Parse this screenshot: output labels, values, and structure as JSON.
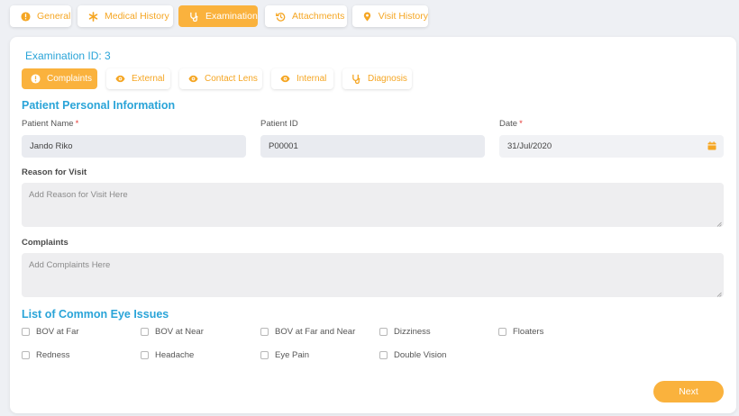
{
  "top_tabs": [
    {
      "label": "General",
      "icon": "info-circle-icon"
    },
    {
      "label": "Medical History",
      "icon": "asterisk-icon"
    },
    {
      "label": "Examination",
      "icon": "stethoscope-icon",
      "active": true
    },
    {
      "label": "Attachments",
      "icon": "history-icon"
    },
    {
      "label": "Visit History",
      "icon": "map-pin-icon"
    }
  ],
  "exam_id": "Examination ID: 3",
  "sub_tabs": [
    {
      "label": "Complaints",
      "icon": "info-circle-icon",
      "active": true
    },
    {
      "label": "External",
      "icon": "eye-icon"
    },
    {
      "label": "Contact Lens",
      "icon": "eye-icon"
    },
    {
      "label": "Internal",
      "icon": "eye-icon"
    },
    {
      "label": "Diagnosis",
      "icon": "stethoscope-icon"
    }
  ],
  "personal": {
    "title": "Patient Personal Information",
    "patient_name_label": "Patient Name",
    "patient_name_value": "Jando Riko",
    "patient_id_label": "Patient ID",
    "patient_id_value": "P00001",
    "date_label": "Date",
    "date_value": "31/Jul/2020",
    "required_mark": "*"
  },
  "reason": {
    "label": "Reason for Visit",
    "placeholder": "Add Reason for Visit Here"
  },
  "complaints": {
    "label": "Complaints",
    "placeholder": "Add Complaints Here"
  },
  "eye_issues": {
    "title": "List of Common Eye Issues",
    "items": [
      "BOV at Far",
      "BOV at Near",
      "BOV at Far and Near",
      "Dizziness",
      "Floaters",
      "Redness",
      "Headache",
      "Eye Pain",
      "Double Vision"
    ]
  },
  "next_label": "Next",
  "colors": {
    "accent": "#fab23d",
    "heading": "#2aa4d8",
    "required": "#e53935"
  }
}
